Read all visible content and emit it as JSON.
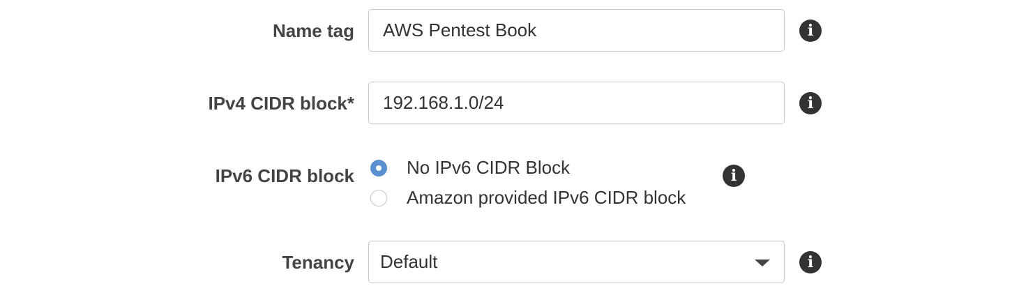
{
  "name_tag": {
    "label": "Name tag",
    "value": "AWS Pentest Book"
  },
  "ipv4": {
    "label": "IPv4 CIDR block*",
    "value": "192.168.1.0/24"
  },
  "ipv6": {
    "label": "IPv6 CIDR block",
    "options": [
      {
        "label": "No IPv6 CIDR Block",
        "selected": true
      },
      {
        "label": "Amazon provided IPv6 CIDR block",
        "selected": false
      }
    ]
  },
  "tenancy": {
    "label": "Tenancy",
    "value": "Default"
  },
  "info_glyph": "i",
  "colors": {
    "radio_selected": "#5a8fd0",
    "info_icon": "#333333",
    "border": "#c7c7c7"
  },
  "icons": [
    "info-icon",
    "chevron-down-icon"
  ]
}
